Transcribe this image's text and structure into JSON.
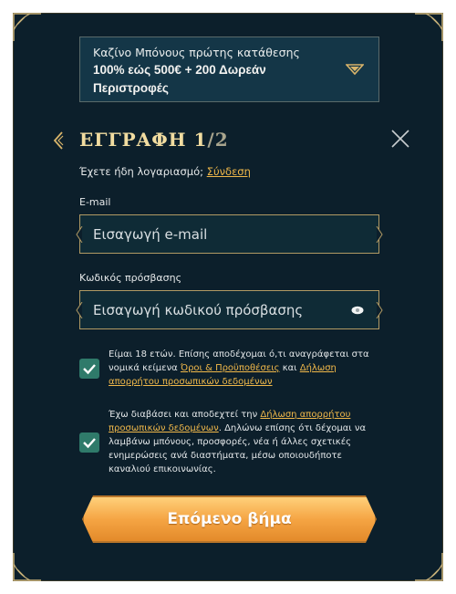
{
  "bonus": {
    "top_line": "Καζίνο Μπόνους πρώτης κατάθεσης",
    "main_line": "100% εώς 500€ + 200 Δωρεάν Περιστροφές"
  },
  "header": {
    "title": "ΕΓΓΡΑΦΗ 1",
    "step_total": "/2"
  },
  "login": {
    "prompt": "Έχετε ήδη λογαριασμό;",
    "link": "Σύνδεση"
  },
  "email": {
    "label": "E-mail",
    "placeholder": "Εισαγωγή e-mail",
    "value": ""
  },
  "password": {
    "label": "Κωδικός πρόσβασης",
    "placeholder": "Εισαγωγή κωδικού πρόσβασης",
    "value": ""
  },
  "consent_terms": {
    "checked": true,
    "text_1": "Είμαι 18 ετών. Επίσης αποδέχομαι ό,τι αναγράφεται στα νομικά κείμενα",
    "link_terms": "Όροι & Προϋποθέσεις",
    "text_and": "και",
    "link_privacy": "Δήλωση απορρήτου προσωπικών δεδομένων"
  },
  "consent_marketing": {
    "checked": true,
    "text_1": "Έχω διαβάσει και αποδεχτεί την",
    "link_privacy": "Δήλωση απορρήτου προσωπικών δεδομένων",
    "text_2": ". Δηλώνω επίσης ότι δέχομαι να λαμβάνω μπόνους, προσφορές, νέα ή άλλες σχετικές ενημερώσεις ανά διαστήματα, μέσω οποιουδήποτε καναλιού επικοινωνίας."
  },
  "next_button": {
    "label": "Επόμενο βήμα"
  },
  "colors": {
    "panel_bg": "#0c1f2b",
    "accent_gold": "#f0b84a",
    "title_gold": "#f1dca0",
    "checkbox_green": "#2f7a6a",
    "button_orange": "#f5a544"
  },
  "icons": {
    "bonus_toggle": "chevron-down-icon",
    "back": "chevron-left-icon",
    "close": "close-icon",
    "password_toggle": "eye-icon",
    "check": "check-icon"
  }
}
